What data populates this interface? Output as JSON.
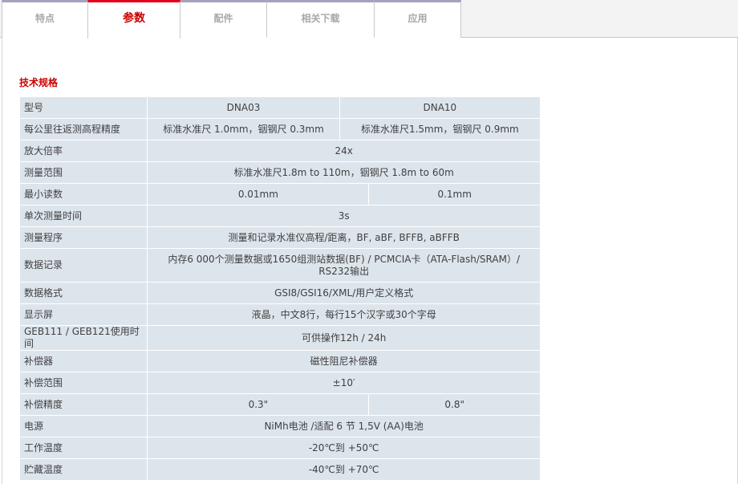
{
  "tabs": [
    {
      "label": "特点",
      "active": false
    },
    {
      "label": "参数",
      "active": true
    },
    {
      "label": "配件",
      "active": false
    },
    {
      "label": "相关下载",
      "active": false
    },
    {
      "label": "应用",
      "active": false
    }
  ],
  "section_title": "技术规格",
  "spec": {
    "header": {
      "label": "型号",
      "col1": "DNA03",
      "col2": "DNA10"
    },
    "rows": {
      "accuracy": {
        "label": "每公里往返测高程精度",
        "col1": "标准水准尺 1.0mm，铟钢尺 0.3mm",
        "col2": "标准水准尺1.5mm，铟钢尺 0.9mm"
      },
      "magnification": {
        "label": "放大倍率",
        "value": "24x"
      },
      "range": {
        "label": "测量范围",
        "value": "标准水准尺1.8m to 110m，铟钢尺 1.8m to 60m"
      },
      "min_reading": {
        "label": "最小读数",
        "col1": "0.01mm",
        "col2": "0.1mm"
      },
      "single_time": {
        "label": "单次测量时间",
        "value": "3s"
      },
      "program": {
        "label": "测量程序",
        "value": "测量和记录水准仪高程/距离，BF, aBF, BFFB, aBFFB"
      },
      "data_record": {
        "label": "数据记录",
        "value": "内存6 000个测量数据或1650组测站数据(BF) / PCMCIA卡（ATA-Flash/SRAM）/ RS232输出"
      },
      "data_format": {
        "label": "数据格式",
        "value": "GSI8/GSI16/XML/用户定义格式"
      },
      "display": {
        "label": "显示屏",
        "value": "液晶，中文8行，每行15个汉字或30个字母"
      },
      "battery_time": {
        "label": "GEB111 / GEB121使用时间",
        "value": "可供操作12h / 24h"
      },
      "compensator": {
        "label": "补偿器",
        "value": "磁性阻尼补偿器"
      },
      "comp_range": {
        "label": "补偿范围",
        "value": "±10′"
      },
      "comp_accuracy": {
        "label": "补偿精度",
        "col1": "0.3\"",
        "col2": "0.8\""
      },
      "power": {
        "label": "电源",
        "value": "NiMh电池 /适配 6 节 1,5V (AA)电池"
      },
      "work_temp": {
        "label": "工作温度",
        "value": "-20℃到 +50℃"
      },
      "storage_temp": {
        "label": "贮藏温度",
        "value": "-40℃到 +70℃"
      }
    }
  }
}
